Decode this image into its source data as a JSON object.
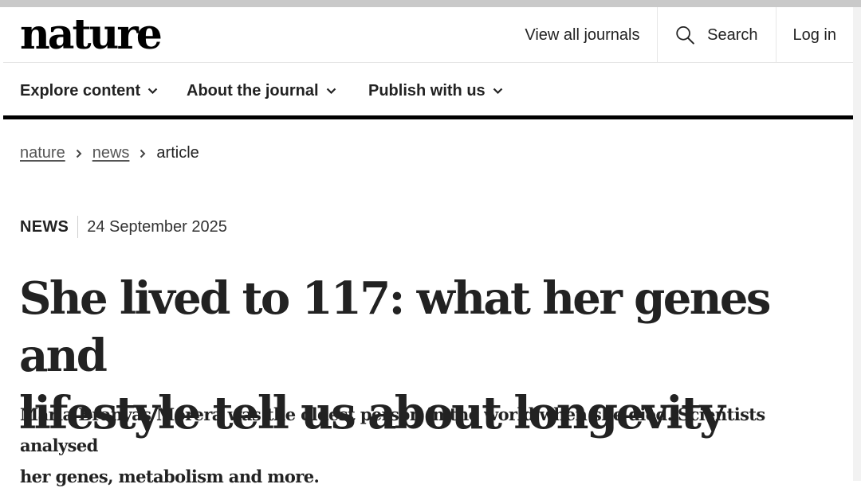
{
  "header": {
    "logo": "nature",
    "view_all_journals": "View all journals",
    "search_label": "Search",
    "login_label": "Log in"
  },
  "nav": {
    "items": [
      {
        "label": "Explore content"
      },
      {
        "label": "About the journal"
      },
      {
        "label": "Publish with us"
      }
    ]
  },
  "breadcrumb": {
    "items": [
      "nature",
      "news",
      "article"
    ]
  },
  "article": {
    "type": "NEWS",
    "date": "24 September 2025",
    "title_line1": "She lived to 117: what her genes and",
    "title_line2": "lifestyle tell us about longevity",
    "standfirst_line1": "Maria Branyas Morera was the oldest person in the world when she died. Scientists analysed",
    "standfirst_line2": "her genes, metabolism and more."
  },
  "icons": {
    "search": "search-icon",
    "chevron": "chevron-down-icon",
    "breadcrumb_separator": "chevron-right-icon"
  },
  "colors": {
    "text": "#222222",
    "muted_link": "#555555",
    "nav_rule": "#000000",
    "top_strip": "#c9c9c9"
  }
}
